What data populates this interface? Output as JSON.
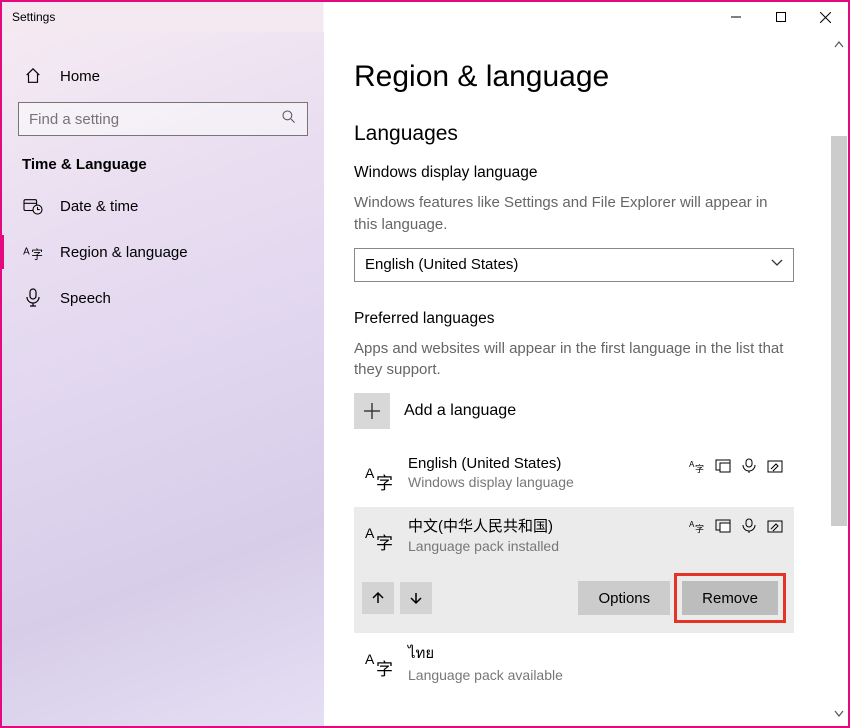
{
  "window": {
    "title": "Settings"
  },
  "sidebar": {
    "home": "Home",
    "search_placeholder": "Find a setting",
    "category": "Time & Language",
    "items": [
      {
        "label": "Date & time"
      },
      {
        "label": "Region & language"
      },
      {
        "label": "Speech"
      }
    ]
  },
  "page": {
    "title": "Region & language",
    "languages_h": "Languages",
    "display_h": "Windows display language",
    "display_desc": "Windows features like Settings and File Explorer will appear in this language.",
    "display_value": "English (United States)",
    "preferred_h": "Preferred languages",
    "preferred_desc": "Apps and websites will appear in the first language in the list that they support.",
    "add_label": "Add a language",
    "langs": [
      {
        "name": "English (United States)",
        "sub": "Windows display language"
      },
      {
        "name": "中文(中华人民共和国)",
        "sub": "Language pack installed"
      },
      {
        "name": "ไทย",
        "sub": "Language pack available"
      }
    ],
    "options_btn": "Options",
    "remove_btn": "Remove"
  }
}
